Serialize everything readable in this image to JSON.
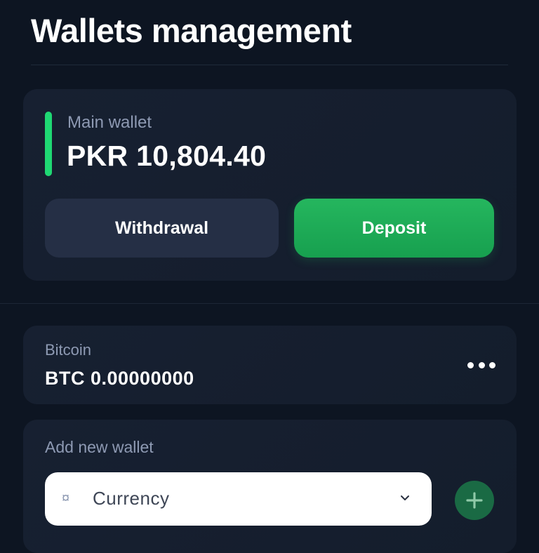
{
  "page": {
    "title": "Wallets management"
  },
  "main_wallet": {
    "label": "Main wallet",
    "balance": "PKR 10,804.40",
    "accent_color": "#1fd873",
    "withdraw_label": "Withdrawal",
    "deposit_label": "Deposit",
    "deposit_color": "#1faa57"
  },
  "wallets": [
    {
      "name": "Bitcoin",
      "balance": "BTC 0.00000000",
      "menu_icon": "more-horizontal-icon"
    }
  ],
  "add_wallet": {
    "label": "Add new wallet",
    "select": {
      "icon": "currency-icon",
      "value": "Currency",
      "chevron_icon": "chevron-down-icon"
    },
    "add_icon": "plus-icon",
    "add_color": "#1a6a44"
  },
  "colors": {
    "background": "#0d1522",
    "card": "#172031",
    "muted_text": "#8e9ab3"
  }
}
